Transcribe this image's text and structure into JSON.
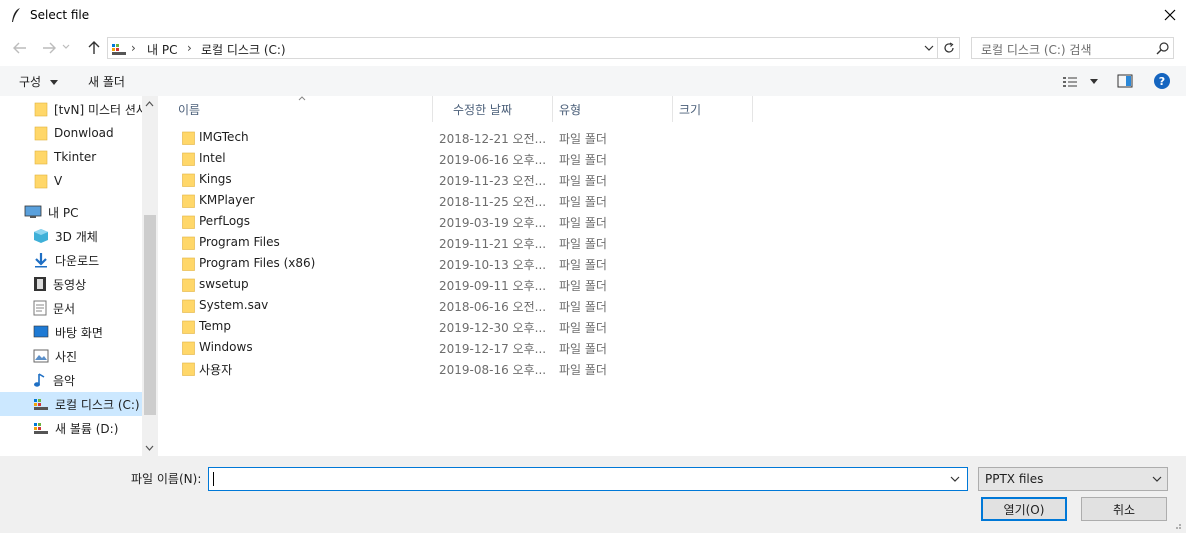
{
  "window": {
    "title": "Select file",
    "close_icon": "close-icon"
  },
  "nav": {
    "back_icon": "arrow-left-icon",
    "forward_icon": "arrow-right-icon",
    "up_icon": "arrow-up-icon",
    "breadcrumb": [
      "내 PC",
      "로컬 디스크 (C:)"
    ],
    "search_placeholder": "로컬 디스크 (C:) 검색"
  },
  "toolbar": {
    "organize": "구성",
    "new_folder": "새 폴더"
  },
  "sidebar": {
    "items": [
      {
        "label": "[tvN] 미스터 션샤인",
        "icon": "folder-icon"
      },
      {
        "label": "Donwload",
        "icon": "folder-icon"
      },
      {
        "label": "Tkinter",
        "icon": "folder-icon"
      },
      {
        "label": "V",
        "icon": "folder-icon"
      },
      {
        "label": "내 PC",
        "icon": "computer-icon"
      },
      {
        "label": "3D 개체",
        "icon": "cube-icon"
      },
      {
        "label": "다운로드",
        "icon": "download-icon"
      },
      {
        "label": "동영상",
        "icon": "video-icon"
      },
      {
        "label": "문서",
        "icon": "document-icon"
      },
      {
        "label": "바탕 화면",
        "icon": "desktop-icon"
      },
      {
        "label": "사진",
        "icon": "picture-icon"
      },
      {
        "label": "음악",
        "icon": "music-icon"
      },
      {
        "label": "로컬 디스크 (C:)",
        "icon": "drive-icon",
        "selected": true
      },
      {
        "label": "새 볼륨 (D:)",
        "icon": "drive-icon"
      }
    ]
  },
  "columns": {
    "name": "이름",
    "date": "수정한 날짜",
    "type": "유형",
    "size": "크기"
  },
  "files": [
    {
      "name": "IMGTech",
      "date": "2018-12-21 오전...",
      "type": "파일 폴더"
    },
    {
      "name": "Intel",
      "date": "2019-06-16 오후...",
      "type": "파일 폴더"
    },
    {
      "name": "Kings",
      "date": "2019-11-23 오전...",
      "type": "파일 폴더"
    },
    {
      "name": "KMPlayer",
      "date": "2018-11-25 오전...",
      "type": "파일 폴더"
    },
    {
      "name": "PerfLogs",
      "date": "2019-03-19 오후...",
      "type": "파일 폴더"
    },
    {
      "name": "Program Files",
      "date": "2019-11-21 오후...",
      "type": "파일 폴더"
    },
    {
      "name": "Program Files (x86)",
      "date": "2019-10-13 오후...",
      "type": "파일 폴더"
    },
    {
      "name": "swsetup",
      "date": "2019-09-11 오후...",
      "type": "파일 폴더"
    },
    {
      "name": "System.sav",
      "date": "2018-06-16 오전...",
      "type": "파일 폴더"
    },
    {
      "name": "Temp",
      "date": "2019-12-30 오후...",
      "type": "파일 폴더"
    },
    {
      "name": "Windows",
      "date": "2019-12-17 오후...",
      "type": "파일 폴더"
    },
    {
      "name": "사용자",
      "date": "2019-08-16 오후...",
      "type": "파일 폴더"
    }
  ],
  "footer": {
    "filename_label": "파일 이름(N):",
    "filename_value": "",
    "filetype": "PPTX files",
    "open": "열기(O)",
    "cancel": "취소"
  },
  "colors": {
    "accent": "#0078d7",
    "selected": "#cce8ff",
    "folder": "#ffd769"
  }
}
